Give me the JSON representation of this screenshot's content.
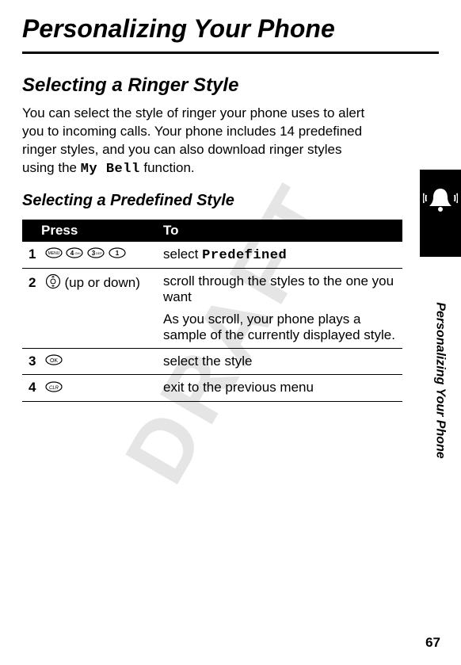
{
  "watermark": "DRAFT",
  "chapter_title": "Personalizing Your Phone",
  "section_title": "Selecting a Ringer Style",
  "intro_part1": "You can select the style of ringer your phone uses to alert you to incoming calls. Your phone includes 14 predefined ringer styles, and you can also download ringer styles using the ",
  "intro_mono": "My Bell",
  "intro_part2": " function.",
  "subsection_title": "Selecting a Predefined Style",
  "table": {
    "header_press": "Press",
    "header_to": "To",
    "rows": [
      {
        "num": "1",
        "press_suffix": "",
        "to": "select ",
        "to_mono": "Predefined"
      },
      {
        "num": "2",
        "press_suffix": " (up or down)",
        "to": "scroll through the styles to the one you want",
        "to_note": "As you scroll, your phone plays a sample of the currently displayed style."
      },
      {
        "num": "3",
        "press_suffix": "",
        "to": "select the style"
      },
      {
        "num": "4",
        "press_suffix": "",
        "to": "exit to the previous menu"
      }
    ]
  },
  "side_label": "Personalizing Your Phone",
  "page_number": "67"
}
